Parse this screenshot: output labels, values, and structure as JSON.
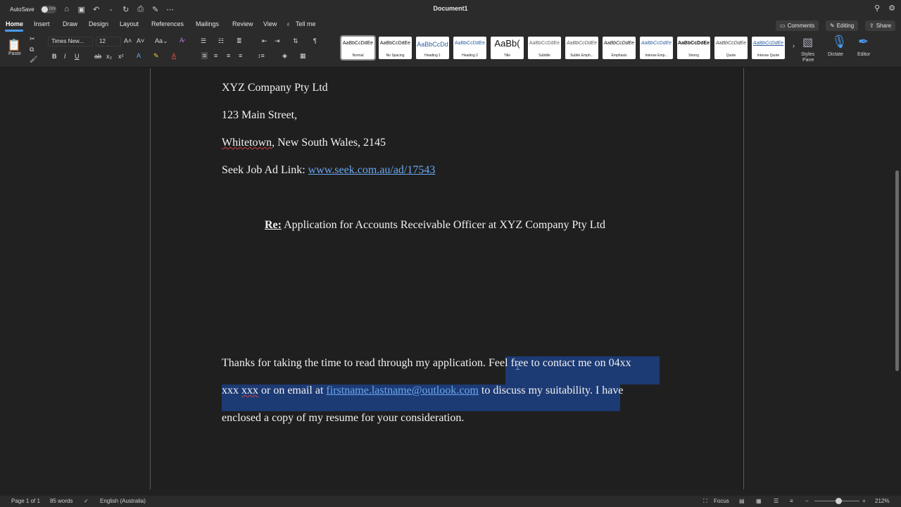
{
  "titlebar": {
    "autosave_label": "AutoSave",
    "autosave_state": "OFF",
    "document_title": "Document1"
  },
  "menu": {
    "tabs": [
      "Home",
      "Insert",
      "Draw",
      "Design",
      "Layout",
      "References",
      "Mailings",
      "Review",
      "View"
    ],
    "tell_me": "Tell me",
    "comments": "Comments",
    "editing": "Editing",
    "share": "Share"
  },
  "ribbon": {
    "paste_label": "Paste",
    "font_name": "Times New...",
    "font_size": "12",
    "styles": [
      {
        "preview": "AaBbCcDdEe",
        "name": "Normal"
      },
      {
        "preview": "AaBbCcDdEe",
        "name": "No Spacing"
      },
      {
        "preview": "AaBbCcDd",
        "name": "Heading 1"
      },
      {
        "preview": "AaBbCcDdEe",
        "name": "Heading 2"
      },
      {
        "preview": "AaBb(",
        "name": "Title"
      },
      {
        "preview": "AaBbCcDdEe",
        "name": "Subtitle"
      },
      {
        "preview": "AaBbCcDdEe",
        "name": "Subtle Emph..."
      },
      {
        "preview": "AaBbCcDdEe",
        "name": "Emphasis"
      },
      {
        "preview": "AaBbCcDdEe",
        "name": "Intense Emp..."
      },
      {
        "preview": "AaBbCcDdEe",
        "name": "Strong"
      },
      {
        "preview": "AaBbCcDdEe",
        "name": "Quote"
      },
      {
        "preview": "AaBbCcDdEe",
        "name": "Intense Quote"
      }
    ],
    "styles_pane_line1": "Styles",
    "styles_pane_line2": "Pane",
    "dictate": "Dictate",
    "editor": "Editor"
  },
  "document": {
    "company": "XYZ Company Pty Ltd",
    "street": "123 Main Street,",
    "city_word": "Whitetown",
    "city_rest": ", New South Wales, 2145",
    "seek_label": "Seek Job Ad Link: ",
    "seek_link": "www.seek.com.au/ad/17543",
    "re_label": "Re:",
    "re_text": " Application for Accounts Receivable Officer at XYZ Company Pty Ltd",
    "para_line1": "Thanks for taking the time to read through my application. Feel free to contact me on 04xx",
    "para_line2_a": "xxx ",
    "para_line2_b": "xxx",
    "para_line2_c": " or on email at ",
    "para_email": "firstname.lastname@outlook.com",
    "para_line2_d": " to discuss my suitability. I have",
    "para_line3": "enclosed a copy of my resume for your consideration."
  },
  "status": {
    "page": "Page 1 of 1",
    "words": "85 words",
    "language": "English (Australia)",
    "focus": "Focus",
    "zoom": "212%",
    "zoom_fraction": 0.53
  }
}
